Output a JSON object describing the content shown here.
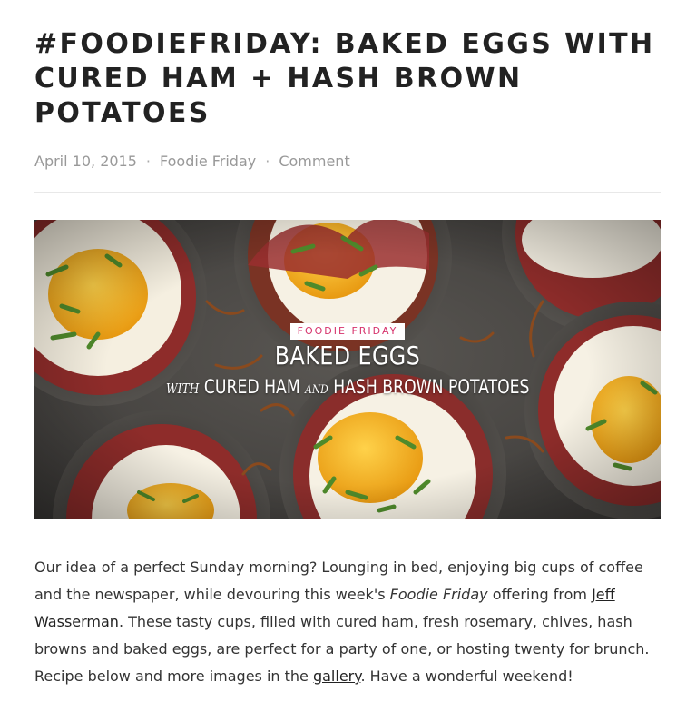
{
  "post": {
    "title": "#FOODIEFRIDAY: BAKED EGGS WITH CURED HAM + HASH BROWN POTATOES",
    "meta": {
      "date": "April 10, 2015",
      "separator": "·",
      "category": "Foodie Friday",
      "comments": "Comment"
    },
    "hero": {
      "badge": "FOODIE FRIDAY",
      "headline": "BAKED EGGS",
      "sub_with": "WITH",
      "sub_main_1": "CURED HAM",
      "sub_and": "AND",
      "sub_main_2": "HASH BROWN POTATOES"
    },
    "body": {
      "part1": "Our idea of a perfect Sunday morning? Lounging in bed, enjoying big cups of coffee and the newspaper, while devouring this week's ",
      "em": "Foodie Friday",
      "part2": " offering from ",
      "link_author": "Jeff Wasserman",
      "part3": ". These tasty cups, filled with cured ham, fresh rosemary, chives, hash browns and baked eggs, are perfect for a party of one, or hosting twenty for brunch. Recipe below and more images in the ",
      "link_gallery": "gallery",
      "part4": ". Have a wonderful weekend!"
    }
  },
  "colors": {
    "title": "#222222",
    "meta": "#999999",
    "badge_pink": "#d6336c",
    "tin": "#4a4846",
    "ham": "#9a2f2f",
    "yolk": "#f2b522",
    "white": "#f6f1e4",
    "chive": "#4f8a2b"
  }
}
